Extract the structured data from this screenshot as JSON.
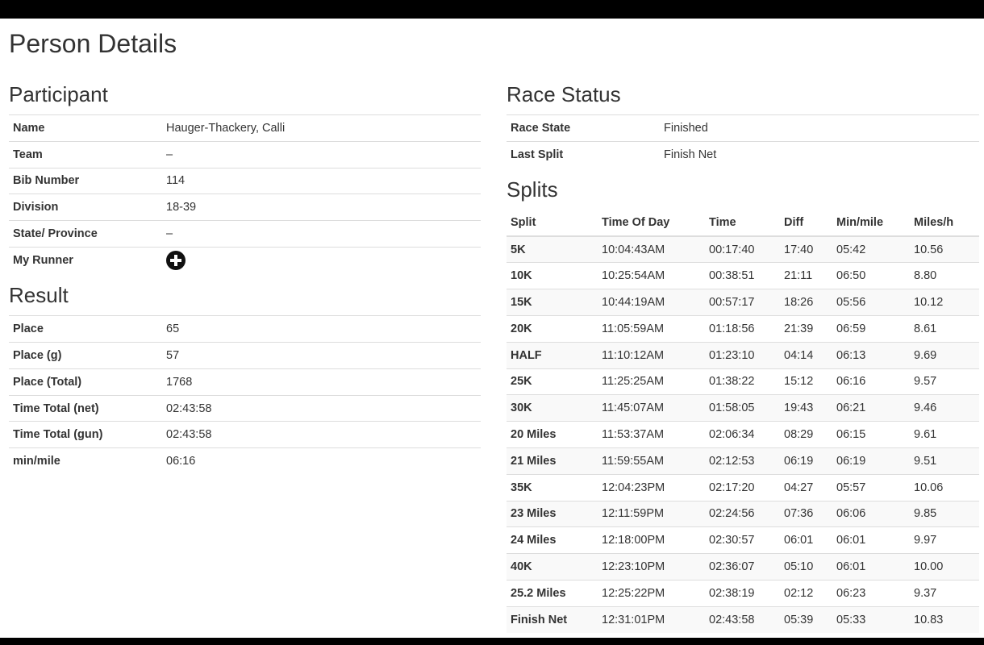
{
  "page": {
    "title": "Person Details"
  },
  "participant": {
    "heading": "Participant",
    "rows": [
      {
        "label": "Name",
        "value": "Hauger-Thackery, Calli"
      },
      {
        "label": "Team",
        "value": "–"
      },
      {
        "label": "Bib Number",
        "value": "114"
      },
      {
        "label": "Division",
        "value": "18-39"
      },
      {
        "label": "State/ Province",
        "value": "–"
      }
    ],
    "my_runner": {
      "label": "My Runner",
      "icon": "add-circle-icon"
    }
  },
  "result": {
    "heading": "Result",
    "rows": [
      {
        "label": "Place",
        "value": "65"
      },
      {
        "label": "Place (g)",
        "value": "57"
      },
      {
        "label": "Place (Total)",
        "value": "1768"
      },
      {
        "label": "Time Total (net)",
        "value": "02:43:58"
      },
      {
        "label": "Time Total (gun)",
        "value": "02:43:58"
      },
      {
        "label": "min/mile",
        "value": "06:16"
      }
    ]
  },
  "race_status": {
    "heading": "Race Status",
    "rows": [
      {
        "label": "Race State",
        "value": "Finished"
      },
      {
        "label": "Last Split",
        "value": "Finish Net"
      }
    ]
  },
  "splits": {
    "heading": "Splits",
    "columns": [
      "Split",
      "Time Of Day",
      "Time",
      "Diff",
      "Min/mile",
      "Miles/h"
    ],
    "rows": [
      [
        "5K",
        "10:04:43AM",
        "00:17:40",
        "17:40",
        "05:42",
        "10.56"
      ],
      [
        "10K",
        "10:25:54AM",
        "00:38:51",
        "21:11",
        "06:50",
        "8.80"
      ],
      [
        "15K",
        "10:44:19AM",
        "00:57:17",
        "18:26",
        "05:56",
        "10.12"
      ],
      [
        "20K",
        "11:05:59AM",
        "01:18:56",
        "21:39",
        "06:59",
        "8.61"
      ],
      [
        "HALF",
        "11:10:12AM",
        "01:23:10",
        "04:14",
        "06:13",
        "9.69"
      ],
      [
        "25K",
        "11:25:25AM",
        "01:38:22",
        "15:12",
        "06:16",
        "9.57"
      ],
      [
        "30K",
        "11:45:07AM",
        "01:58:05",
        "19:43",
        "06:21",
        "9.46"
      ],
      [
        "20 Miles",
        "11:53:37AM",
        "02:06:34",
        "08:29",
        "06:15",
        "9.61"
      ],
      [
        "21 Miles",
        "11:59:55AM",
        "02:12:53",
        "06:19",
        "06:19",
        "9.51"
      ],
      [
        "35K",
        "12:04:23PM",
        "02:17:20",
        "04:27",
        "05:57",
        "10.06"
      ],
      [
        "23 Miles",
        "12:11:59PM",
        "02:24:56",
        "07:36",
        "06:06",
        "9.85"
      ],
      [
        "24 Miles",
        "12:18:00PM",
        "02:30:57",
        "06:01",
        "06:01",
        "9.97"
      ],
      [
        "40K",
        "12:23:10PM",
        "02:36:07",
        "05:10",
        "06:01",
        "10.00"
      ],
      [
        "25.2 Miles",
        "12:25:22PM",
        "02:38:19",
        "02:12",
        "06:23",
        "9.37"
      ],
      [
        "Finish Net",
        "12:31:01PM",
        "02:43:58",
        "05:39",
        "05:33",
        "10.83"
      ]
    ]
  }
}
